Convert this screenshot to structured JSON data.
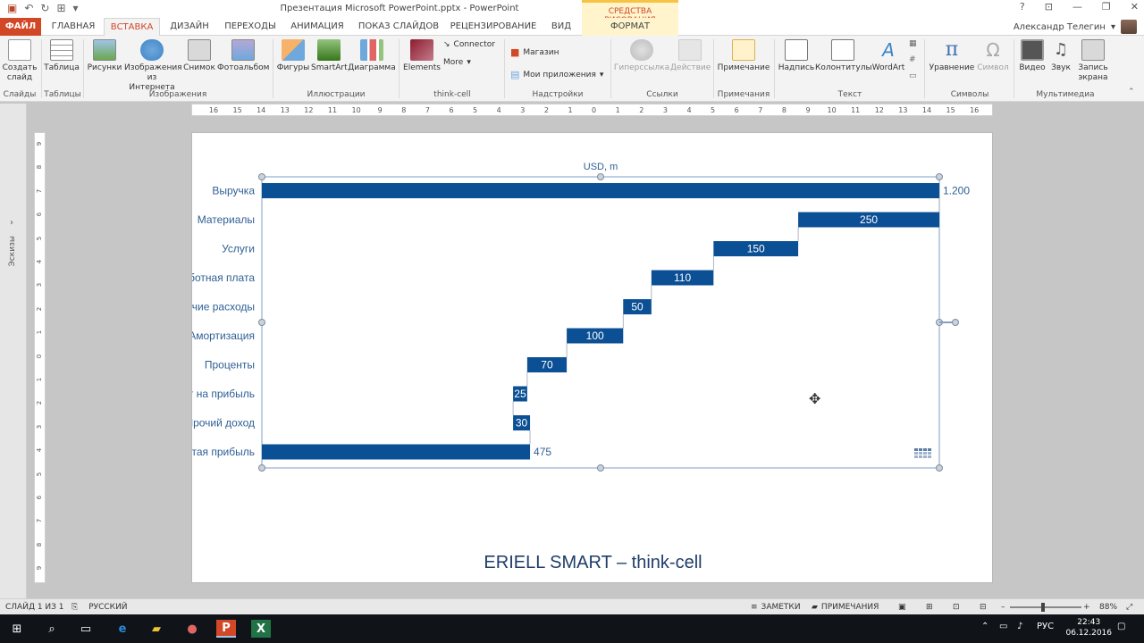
{
  "window": {
    "title": "Презентация Microsoft PowerPoint.pptx - PowerPoint",
    "context_tab_header": "СРЕДСТВА РИСОВАНИЯ",
    "user": "Александр Телегин",
    "controls": [
      "?",
      "⊡",
      "—",
      "❐",
      "✕"
    ]
  },
  "tabs": [
    {
      "label": "ФАЙЛ"
    },
    {
      "label": "ГЛАВНАЯ"
    },
    {
      "label": "ВСТАВКА"
    },
    {
      "label": "ДИЗАЙН"
    },
    {
      "label": "ПЕРЕХОДЫ"
    },
    {
      "label": "АНИМАЦИЯ"
    },
    {
      "label": "ПОКАЗ СЛАЙДОВ"
    },
    {
      "label": "РЕЦЕНЗИРОВАНИЕ"
    },
    {
      "label": "ВИД"
    },
    {
      "label": "ФОРМАТ"
    }
  ],
  "ribbon": {
    "new_slide": "Создать слайд",
    "table": "Таблица",
    "pictures": "Рисунки",
    "online_pictures": "Изображения из Интернета",
    "screenshot": "Снимок",
    "photo_album": "Фотоальбом",
    "shapes": "Фигуры",
    "smartart": "SmartArt",
    "chart": "Диаграмма",
    "elements": "Elements",
    "connector": "Connector",
    "more": "More",
    "store": "Магазин",
    "my_apps": "Мои приложения",
    "hyperlink": "Гиперссылка",
    "action": "Действие",
    "comment": "Примечание",
    "textbox": "Надпись",
    "header_footer": "Колонтитулы",
    "wordart": "WordArt",
    "equation": "Уравнение",
    "symbol": "Символ",
    "video": "Видео",
    "audio": "Звук",
    "screen_recording": "Запись экрана",
    "groups": {
      "slides": "Слайды",
      "tables": "Таблицы",
      "images": "Изображения",
      "illustrations": "Иллюстрации",
      "thinkcell": "think-cell",
      "addins": "Надстройки",
      "links": "Ссылки",
      "comments": "Примечания",
      "text": "Текст",
      "symbols": "Символы",
      "media": "Мультимедиа"
    }
  },
  "ruler": {
    "h_ticks": [
      "16",
      "15",
      "14",
      "13",
      "12",
      "11",
      "10",
      "9",
      "8",
      "7",
      "6",
      "5",
      "4",
      "3",
      "2",
      "1",
      "0",
      "1",
      "2",
      "3",
      "4",
      "5",
      "6",
      "7",
      "8",
      "9",
      "10",
      "11",
      "12",
      "13",
      "14",
      "15",
      "16"
    ],
    "v_ticks": [
      "9",
      "8",
      "7",
      "6",
      "5",
      "4",
      "3",
      "2",
      "1",
      "0",
      "1",
      "2",
      "3",
      "4",
      "5",
      "6",
      "7",
      "8",
      "9"
    ]
  },
  "thumbnails_label": "Эскизы",
  "slide": {
    "title": "ERIELL SMART – think-cell"
  },
  "chart_data": {
    "type": "bar",
    "subtype": "waterfall-horizontal",
    "unit_label": "USD, m",
    "categories": [
      "Выручка",
      "Материалы",
      "Услуги",
      "Заработная плата",
      "Прочие расходы",
      "Амортизация",
      "Проценты",
      "Налог на прибыль",
      "Прочий доход",
      "Чистая прибыль"
    ],
    "values": [
      1200,
      -250,
      -150,
      -110,
      -50,
      -100,
      -70,
      -25,
      30,
      475
    ],
    "labels": [
      "1.200",
      "250",
      "150",
      "110",
      "50",
      "100",
      "70",
      "25",
      "30",
      "475"
    ],
    "kind": [
      "total",
      "delta",
      "delta",
      "delta",
      "delta",
      "delta",
      "delta",
      "delta",
      "delta",
      "total"
    ],
    "xlim": [
      0,
      1200
    ],
    "bar_color": "#0b4f94",
    "label_color": "#2f5f95"
  },
  "statusbar": {
    "slide_info": "СЛАЙД 1 ИЗ 1",
    "language": "РУССКИЙ",
    "notes": "ЗАМЕТКИ",
    "comments": "ПРИМЕЧАНИЯ",
    "zoom": "88%"
  },
  "taskbar": {
    "language": "РУС",
    "time": "22:43",
    "date": "06.12.2016"
  }
}
